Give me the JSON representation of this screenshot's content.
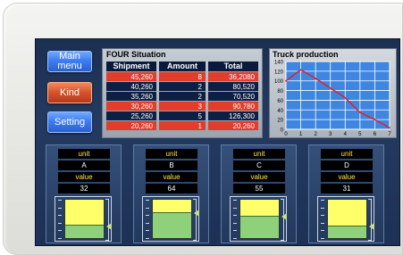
{
  "nav": {
    "main_menu": "Main\nmenu",
    "kind": "Kind",
    "setting": "Setting"
  },
  "table": {
    "title": "FOUR Situation",
    "headers": [
      "Shipment",
      "Amount",
      "Total"
    ],
    "rows": [
      {
        "shipment": "45,260",
        "amount": "8",
        "total": "36,2080",
        "highlight": true
      },
      {
        "shipment": "40,260",
        "amount": "2",
        "total": "80,520",
        "highlight": false
      },
      {
        "shipment": "35,260",
        "amount": "2",
        "total": "70,520",
        "highlight": false
      },
      {
        "shipment": "30,260",
        "amount": "3",
        "total": "90,780",
        "highlight": true
      },
      {
        "shipment": "25,260",
        "amount": "5",
        "total": "126,300",
        "highlight": false
      },
      {
        "shipment": "20,260",
        "amount": "1",
        "total": "20,260",
        "highlight": true
      }
    ]
  },
  "chart_data": {
    "type": "line",
    "title": "Truck production",
    "x": [
      0,
      1,
      2,
      3,
      4,
      5,
      6,
      7
    ],
    "y": [
      100,
      123,
      105,
      85,
      65,
      35,
      20,
      3
    ],
    "x_ticks": [
      "0",
      "1",
      "2",
      "3",
      "4",
      "5",
      "6",
      "7"
    ],
    "y_ticks": [
      "0",
      "20",
      "40",
      "60",
      "80",
      "100",
      "120",
      "140"
    ],
    "xlim": [
      0,
      7
    ],
    "ylim": [
      0,
      140
    ],
    "grid": true,
    "line_color": "#e0202a"
  },
  "tanks": [
    {
      "unit_label": "unit",
      "name": "A",
      "value_label": "value",
      "value": "32",
      "level": 0.32
    },
    {
      "unit_label": "unit",
      "name": "B",
      "value_label": "value",
      "value": "64",
      "level": 0.64
    },
    {
      "unit_label": "unit",
      "name": "C",
      "value_label": "value",
      "value": "55",
      "level": 0.55
    },
    {
      "unit_label": "unit",
      "name": "D",
      "value_label": "value",
      "value": "31",
      "level": 0.31
    }
  ],
  "colors": {
    "screen": "#1d3156",
    "table_highlight": "#e23c2a",
    "table_normal": "#0e1f45",
    "tank_fill": "#8fd07a",
    "tank_empty": "#ffff6a",
    "button_blue": "#3f7df0",
    "button_red": "#d6512c"
  }
}
